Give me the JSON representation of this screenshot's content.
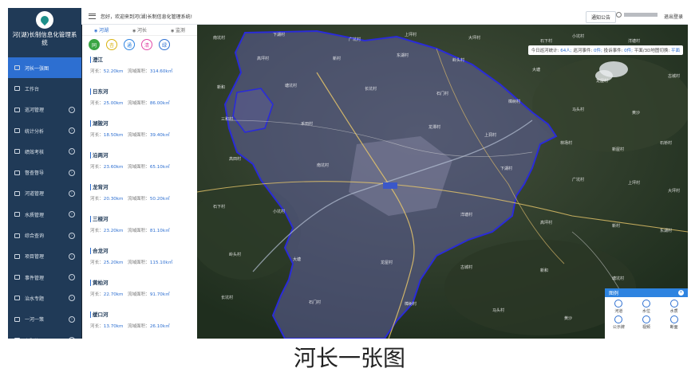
{
  "sidebar": {
    "title": "河(湖)长制信息化管理系统",
    "items": [
      {
        "label": "河长一张图",
        "active": true,
        "arrow": false
      },
      {
        "label": "工作台",
        "active": false,
        "arrow": false
      },
      {
        "label": "巡河管理",
        "active": false,
        "arrow": true
      },
      {
        "label": "统计分析",
        "active": false,
        "arrow": true
      },
      {
        "label": "绩效考核",
        "active": false,
        "arrow": true
      },
      {
        "label": "督查督导",
        "active": false,
        "arrow": true
      },
      {
        "label": "河道管理",
        "active": false,
        "arrow": true
      },
      {
        "label": "水质管理",
        "active": false,
        "arrow": true
      },
      {
        "label": "综合查询",
        "active": false,
        "arrow": true
      },
      {
        "label": "项目管理",
        "active": false,
        "arrow": true
      },
      {
        "label": "事件管理",
        "active": false,
        "arrow": true
      },
      {
        "label": "治水专题",
        "active": false,
        "arrow": true
      },
      {
        "label": "一河一策",
        "active": false,
        "arrow": true
      },
      {
        "label": "专题管理",
        "active": false,
        "arrow": true
      }
    ]
  },
  "topbar": {
    "greeting": "您好，欢迎来到河(湖)长制信息化管理系统!",
    "notice": "通知公告",
    "logout": "退出登录"
  },
  "panel": {
    "tabs": [
      {
        "label": "河湖",
        "active": true
      },
      {
        "label": "河长",
        "active": false
      },
      {
        "label": "监测",
        "active": false
      }
    ],
    "filters": [
      {
        "label": "同",
        "color": "#3aa544",
        "filled": true
      },
      {
        "label": "杏",
        "color": "#d9b310",
        "filled": false
      },
      {
        "label": "通",
        "color": "#2d83e0",
        "filled": false
      },
      {
        "label": "清",
        "color": "#e24aa8",
        "filled": false
      },
      {
        "label": "绿",
        "color": "#2d6fd1",
        "filled": false
      }
    ],
    "length_label": "河长：",
    "area_label": "流域面积：",
    "rivers": [
      {
        "name": "澄江",
        "length": "52.20km",
        "area": "314.60k㎡"
      },
      {
        "name": "日东河",
        "length": "25.00km",
        "area": "86.00k㎡"
      },
      {
        "name": "湖陂河",
        "length": "18.50km",
        "area": "39.40k㎡"
      },
      {
        "name": "沿两河",
        "length": "23.60km",
        "area": "65.10k㎡"
      },
      {
        "name": "龙背河",
        "length": "20.30km",
        "area": "50.20k㎡"
      },
      {
        "name": "三桠河",
        "length": "23.20km",
        "area": "81.10k㎡"
      },
      {
        "name": "合龙河",
        "length": "25.20km",
        "area": "115.10k㎡"
      },
      {
        "name": "黄柏河",
        "length": "22.70km",
        "area": "91.70k㎡"
      },
      {
        "name": "缓口河",
        "length": "13.70km",
        "area": "26.10k㎡"
      }
    ]
  },
  "stats": {
    "today_label": "今日巡河统计:",
    "today_value": "64人;",
    "event_label": "巡河事件:",
    "event_value": "0件;",
    "complaint_label": "投诉事件:",
    "complaint_value": "0件;",
    "switch_label": "平面/3D地图切换:",
    "switch_value": "平面"
  },
  "map_labels": [
    "南坑村",
    "下湖村",
    "广坑村",
    "上坪村",
    "大坪村",
    "石下村",
    "小坑村",
    "洋塘村",
    "高坪村",
    "新村",
    "东湖村",
    "岭头村",
    "大塘",
    "龙屋村",
    "古城村",
    "新和",
    "塘坑村",
    "长坑村",
    "石门村",
    "樟树村",
    "马头村",
    "黄沙",
    "三和村",
    "禾田村",
    "龙潭村",
    "上洞村",
    "林场村",
    "新屋村",
    "石桥村",
    "高田村"
  ],
  "legend": {
    "title": "图例",
    "items": [
      "河道",
      "水位",
      "水质",
      "公示牌",
      "视频",
      "断面"
    ]
  },
  "caption": "河长一张图"
}
